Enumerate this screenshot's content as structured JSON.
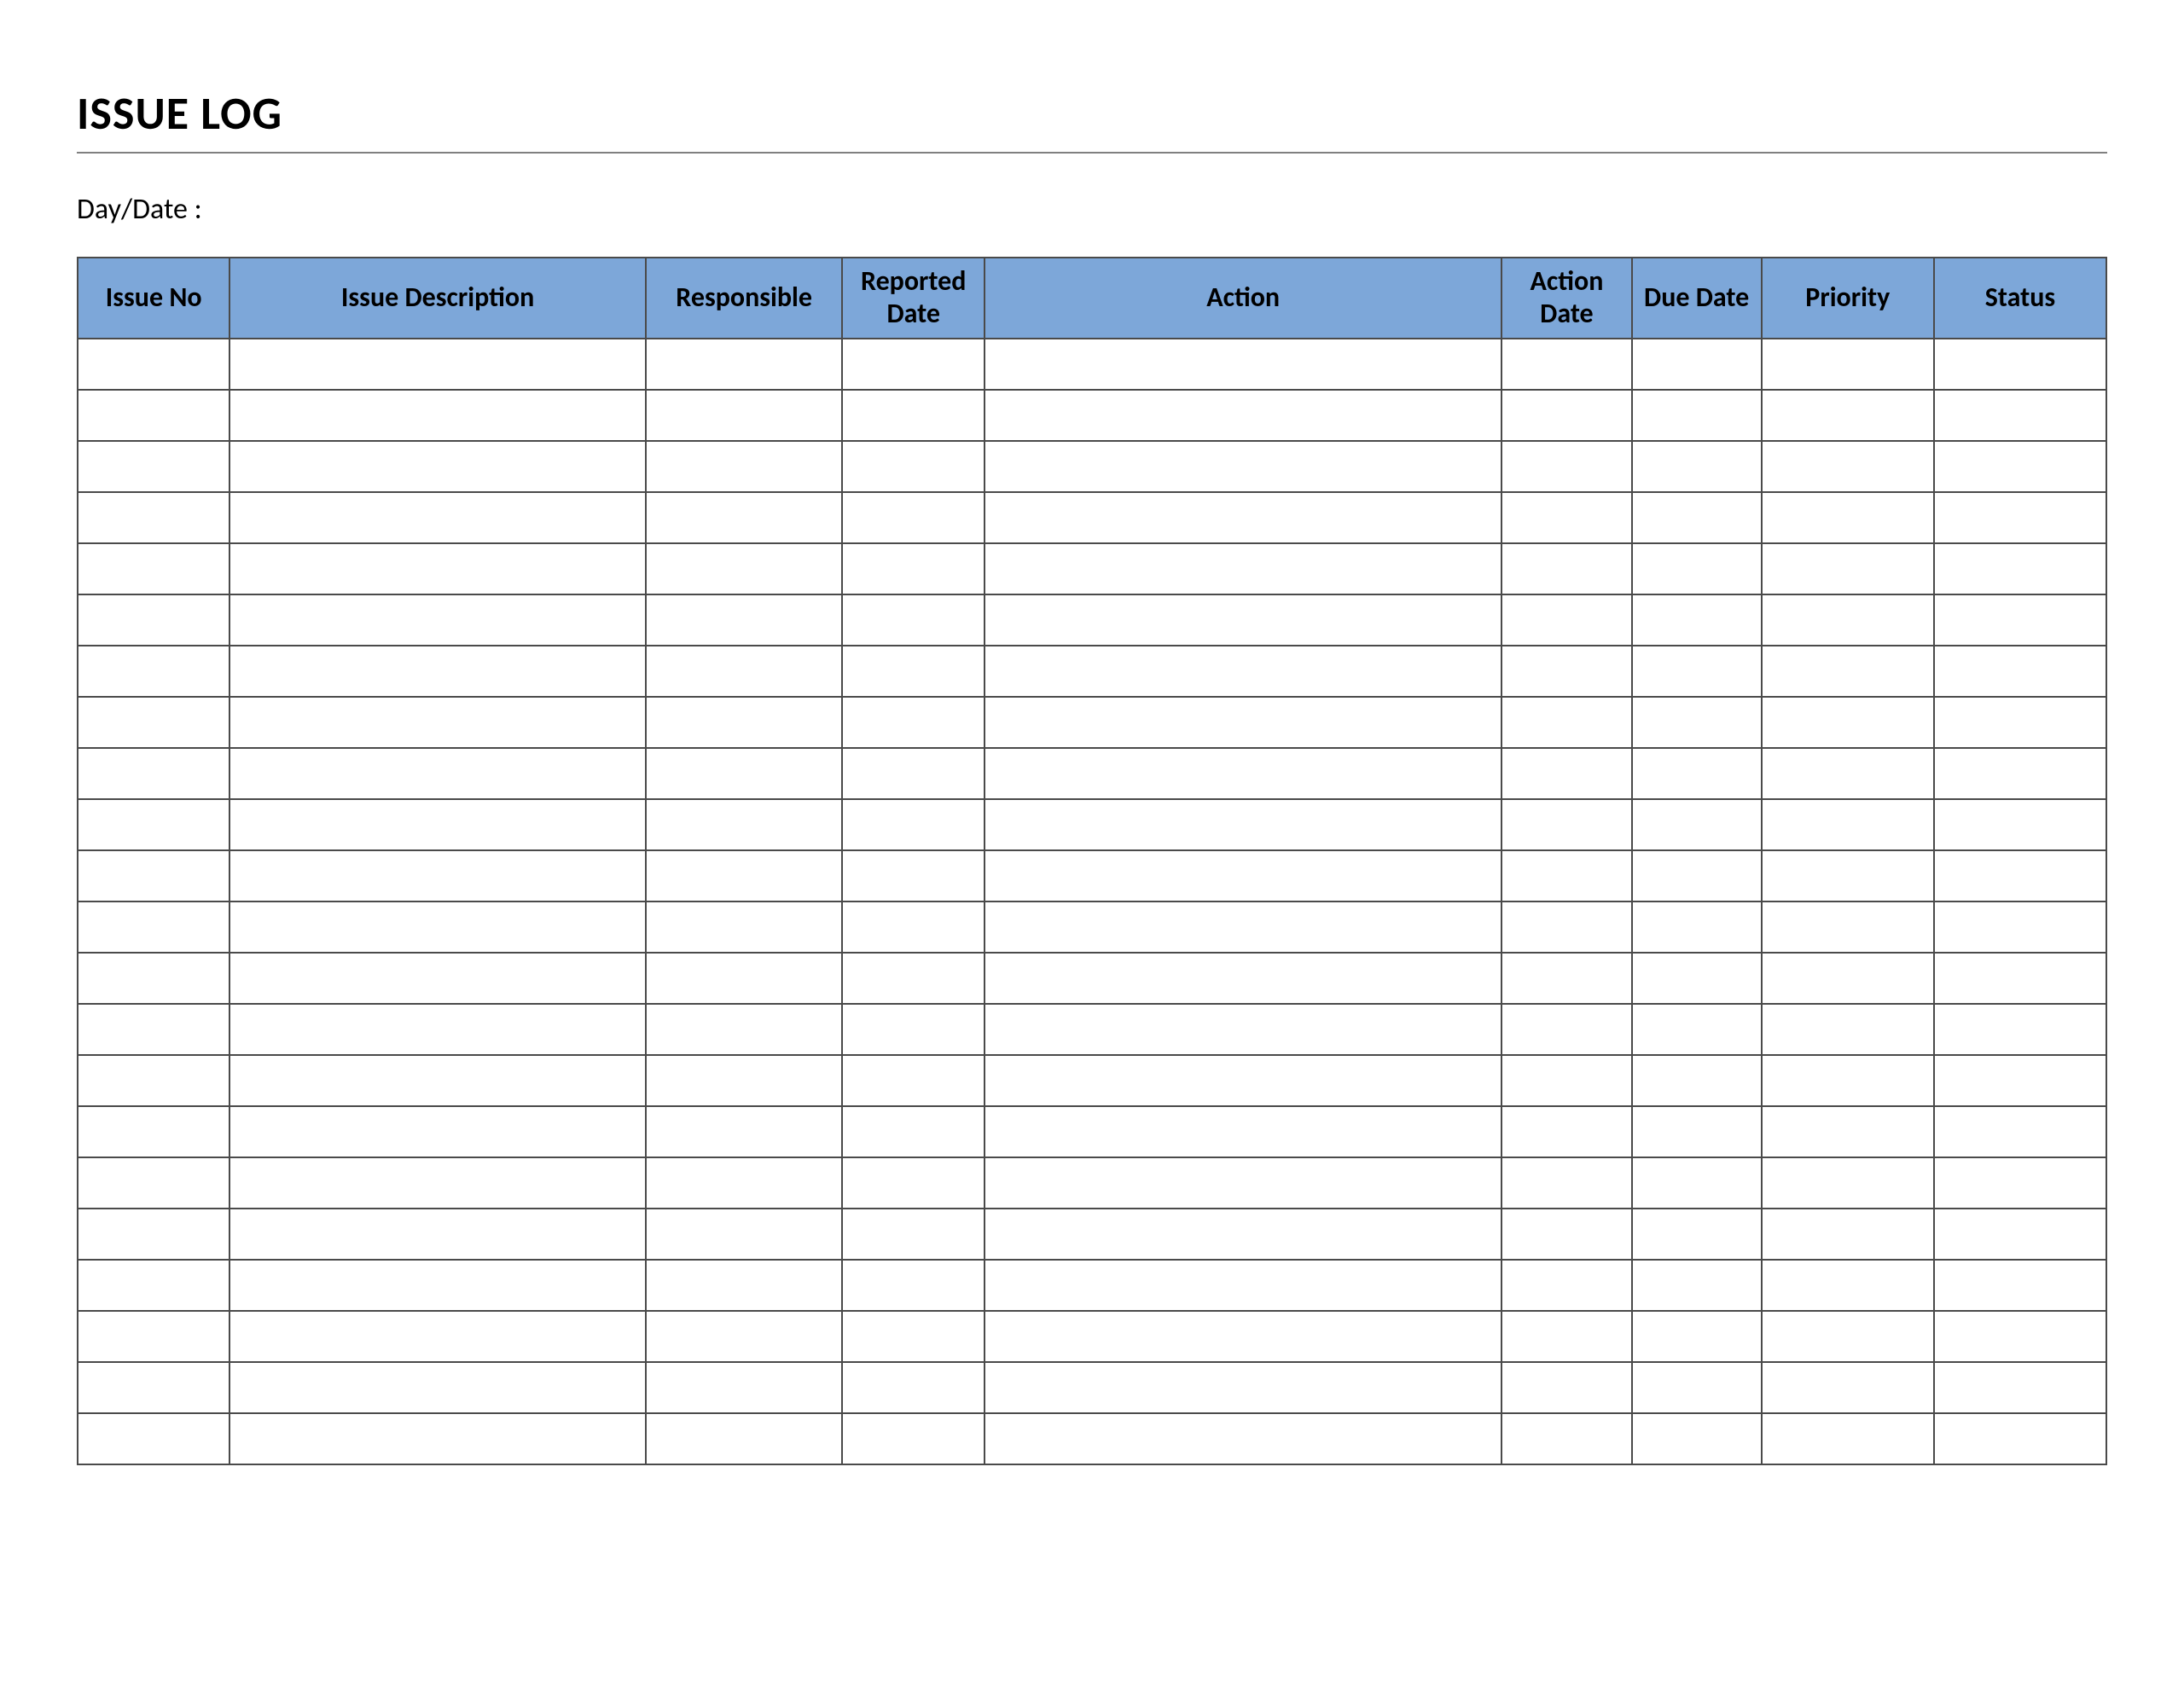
{
  "title": "ISSUE LOG",
  "dayDateLabel": "Day/Date :",
  "columns": {
    "issueNo": "Issue No",
    "issueDescription": "Issue Description",
    "responsible": "Responsible",
    "reportedDate": "Reported Date",
    "action": "Action",
    "actionDate": "Action Date",
    "dueDate": "Due Date",
    "priority": "Priority",
    "status": "Status"
  },
  "rows": [
    {
      "issueNo": "",
      "issueDescription": "",
      "responsible": "",
      "reportedDate": "",
      "action": "",
      "actionDate": "",
      "dueDate": "",
      "priority": "",
      "status": ""
    },
    {
      "issueNo": "",
      "issueDescription": "",
      "responsible": "",
      "reportedDate": "",
      "action": "",
      "actionDate": "",
      "dueDate": "",
      "priority": "",
      "status": ""
    },
    {
      "issueNo": "",
      "issueDescription": "",
      "responsible": "",
      "reportedDate": "",
      "action": "",
      "actionDate": "",
      "dueDate": "",
      "priority": "",
      "status": ""
    },
    {
      "issueNo": "",
      "issueDescription": "",
      "responsible": "",
      "reportedDate": "",
      "action": "",
      "actionDate": "",
      "dueDate": "",
      "priority": "",
      "status": ""
    },
    {
      "issueNo": "",
      "issueDescription": "",
      "responsible": "",
      "reportedDate": "",
      "action": "",
      "actionDate": "",
      "dueDate": "",
      "priority": "",
      "status": ""
    },
    {
      "issueNo": "",
      "issueDescription": "",
      "responsible": "",
      "reportedDate": "",
      "action": "",
      "actionDate": "",
      "dueDate": "",
      "priority": "",
      "status": ""
    },
    {
      "issueNo": "",
      "issueDescription": "",
      "responsible": "",
      "reportedDate": "",
      "action": "",
      "actionDate": "",
      "dueDate": "",
      "priority": "",
      "status": ""
    },
    {
      "issueNo": "",
      "issueDescription": "",
      "responsible": "",
      "reportedDate": "",
      "action": "",
      "actionDate": "",
      "dueDate": "",
      "priority": "",
      "status": ""
    },
    {
      "issueNo": "",
      "issueDescription": "",
      "responsible": "",
      "reportedDate": "",
      "action": "",
      "actionDate": "",
      "dueDate": "",
      "priority": "",
      "status": ""
    },
    {
      "issueNo": "",
      "issueDescription": "",
      "responsible": "",
      "reportedDate": "",
      "action": "",
      "actionDate": "",
      "dueDate": "",
      "priority": "",
      "status": ""
    },
    {
      "issueNo": "",
      "issueDescription": "",
      "responsible": "",
      "reportedDate": "",
      "action": "",
      "actionDate": "",
      "dueDate": "",
      "priority": "",
      "status": ""
    },
    {
      "issueNo": "",
      "issueDescription": "",
      "responsible": "",
      "reportedDate": "",
      "action": "",
      "actionDate": "",
      "dueDate": "",
      "priority": "",
      "status": ""
    },
    {
      "issueNo": "",
      "issueDescription": "",
      "responsible": "",
      "reportedDate": "",
      "action": "",
      "actionDate": "",
      "dueDate": "",
      "priority": "",
      "status": ""
    },
    {
      "issueNo": "",
      "issueDescription": "",
      "responsible": "",
      "reportedDate": "",
      "action": "",
      "actionDate": "",
      "dueDate": "",
      "priority": "",
      "status": ""
    },
    {
      "issueNo": "",
      "issueDescription": "",
      "responsible": "",
      "reportedDate": "",
      "action": "",
      "actionDate": "",
      "dueDate": "",
      "priority": "",
      "status": ""
    },
    {
      "issueNo": "",
      "issueDescription": "",
      "responsible": "",
      "reportedDate": "",
      "action": "",
      "actionDate": "",
      "dueDate": "",
      "priority": "",
      "status": ""
    },
    {
      "issueNo": "",
      "issueDescription": "",
      "responsible": "",
      "reportedDate": "",
      "action": "",
      "actionDate": "",
      "dueDate": "",
      "priority": "",
      "status": ""
    },
    {
      "issueNo": "",
      "issueDescription": "",
      "responsible": "",
      "reportedDate": "",
      "action": "",
      "actionDate": "",
      "dueDate": "",
      "priority": "",
      "status": ""
    },
    {
      "issueNo": "",
      "issueDescription": "",
      "responsible": "",
      "reportedDate": "",
      "action": "",
      "actionDate": "",
      "dueDate": "",
      "priority": "",
      "status": ""
    },
    {
      "issueNo": "",
      "issueDescription": "",
      "responsible": "",
      "reportedDate": "",
      "action": "",
      "actionDate": "",
      "dueDate": "",
      "priority": "",
      "status": ""
    },
    {
      "issueNo": "",
      "issueDescription": "",
      "responsible": "",
      "reportedDate": "",
      "action": "",
      "actionDate": "",
      "dueDate": "",
      "priority": "",
      "status": ""
    },
    {
      "issueNo": "",
      "issueDescription": "",
      "responsible": "",
      "reportedDate": "",
      "action": "",
      "actionDate": "",
      "dueDate": "",
      "priority": "",
      "status": ""
    }
  ]
}
